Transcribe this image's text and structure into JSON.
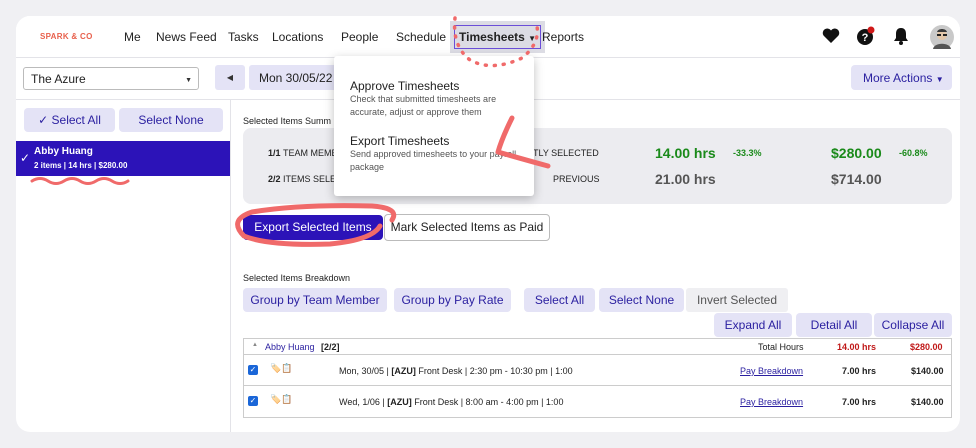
{
  "nav": {
    "logo": "SPARK & CO",
    "links": [
      "Me",
      "News Feed",
      "Tasks",
      "Locations",
      "People",
      "Schedule",
      "Timesheets",
      "Reports"
    ],
    "active_link": "Timesheets",
    "icons": [
      "heart-icon",
      "help-icon",
      "bell-icon",
      "avatar"
    ]
  },
  "toolbar": {
    "location": "The Azure",
    "date": "Mon 30/05/22",
    "more_actions": "More Actions"
  },
  "sidebar": {
    "select_all": "Select All",
    "select_none": "Select None",
    "selected_item": {
      "name": "Abby Huang",
      "meta": "2 items | 14 hrs | $280.00"
    }
  },
  "summary": {
    "title": "Selected Items Summ",
    "row1": {
      "count": "1/1",
      "label": "TEAM MEMB",
      "tail": "TLY SELECTED",
      "hours": "14.00 hrs",
      "hours_pct": "-33.3%",
      "amount": "$280.00",
      "amount_pct": "-60.8%"
    },
    "row2": {
      "count": "2/2",
      "label": "ITEMS SELE",
      "tail": "PREVIOUS",
      "hours": "21.00 hrs",
      "amount": "$714.00"
    }
  },
  "actions": {
    "export": "Export Selected Items",
    "mark_paid": "Mark Selected Items as Paid"
  },
  "breakdown": {
    "title": "Selected Items Breakdown",
    "group_team": "Group by Team Member",
    "group_rate": "Group by Pay Rate",
    "select_all": "Select All",
    "select_none": "Select None",
    "invert": "Invert Selected",
    "expand_all": "Expand All",
    "detail_all": "Detail All",
    "collapse_all": "Collapse All"
  },
  "table": {
    "group_name": "Abby Huang",
    "group_count": "[2/2]",
    "total_label": "Total Hours",
    "total_hours": "14.00 hrs",
    "total_amount": "$280.00",
    "rows": [
      {
        "desc_pre": "Mon, 30/05 | ",
        "loc": "[AZU]",
        "desc_post": " Front Desk | 2:30 pm - 10:30 pm | 1:00",
        "link": "Pay Breakdown",
        "hours": "7.00 hrs",
        "amount": "$140.00"
      },
      {
        "desc_pre": "Wed, 1/06 | ",
        "loc": "[AZU]",
        "desc_post": " Front Desk | 8:00 am - 4:00 pm | 1:00",
        "link": "Pay Breakdown",
        "hours": "7.00 hrs",
        "amount": "$140.00"
      }
    ]
  },
  "dropdown": {
    "items": [
      {
        "title": "Approve Timesheets",
        "desc": "Check that submitted timesheets are accurate, adjust or approve them"
      },
      {
        "title": "Export Timesheets",
        "desc": "Send approved timesheets to your payroll package"
      }
    ]
  },
  "colors": {
    "primary": "#2c13b8",
    "soft": "#e4e3f6",
    "annotation": "#f06a6a",
    "green": "#1a8a1a",
    "red": "#c01818"
  }
}
